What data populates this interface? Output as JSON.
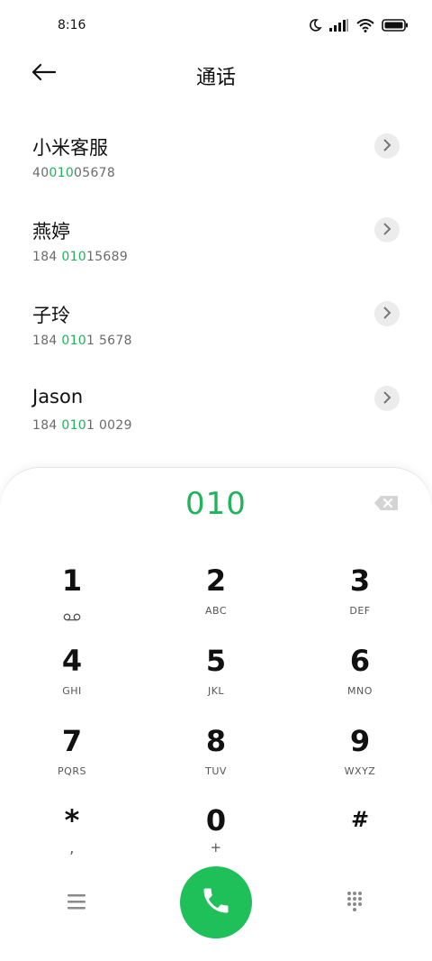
{
  "status": {
    "time": "8:16"
  },
  "header": {
    "title": "通话"
  },
  "contacts": [
    {
      "name": "小米客服",
      "number_pre": "40",
      "number_hl": "010",
      "number_post": "05678"
    },
    {
      "name": "燕婷",
      "number_pre": "184 ",
      "number_hl": "010",
      "number_post": "15689"
    },
    {
      "name": "子玲",
      "number_pre": "184 ",
      "number_hl": "010",
      "number_post": "1 5678"
    },
    {
      "name": "Jason",
      "number_pre": "184 ",
      "number_hl": "010",
      "number_post": "1 0029"
    }
  ],
  "dialpad": {
    "number": "010",
    "keys": [
      {
        "digit": "1",
        "letters": ""
      },
      {
        "digit": "2",
        "letters": "ABC"
      },
      {
        "digit": "3",
        "letters": "DEF"
      },
      {
        "digit": "4",
        "letters": "GHI"
      },
      {
        "digit": "5",
        "letters": "JKL"
      },
      {
        "digit": "6",
        "letters": "MNO"
      },
      {
        "digit": "7",
        "letters": "PQRS"
      },
      {
        "digit": "8",
        "letters": "TUV"
      },
      {
        "digit": "9",
        "letters": "WXYZ"
      },
      {
        "digit": "*",
        "letters": ","
      },
      {
        "digit": "0",
        "letters": "+"
      },
      {
        "digit": "#",
        "letters": ""
      }
    ]
  },
  "colors": {
    "accent": "#1fb35b",
    "call_button": "#1fbf5a"
  },
  "icons": {
    "back": "arrow-left-icon",
    "detail": "chevron-right-icon",
    "backspace": "backspace-icon",
    "voicemail": "voicemail-icon",
    "menu": "menu-icon",
    "call": "phone-icon",
    "keypad": "keypad-icon"
  }
}
